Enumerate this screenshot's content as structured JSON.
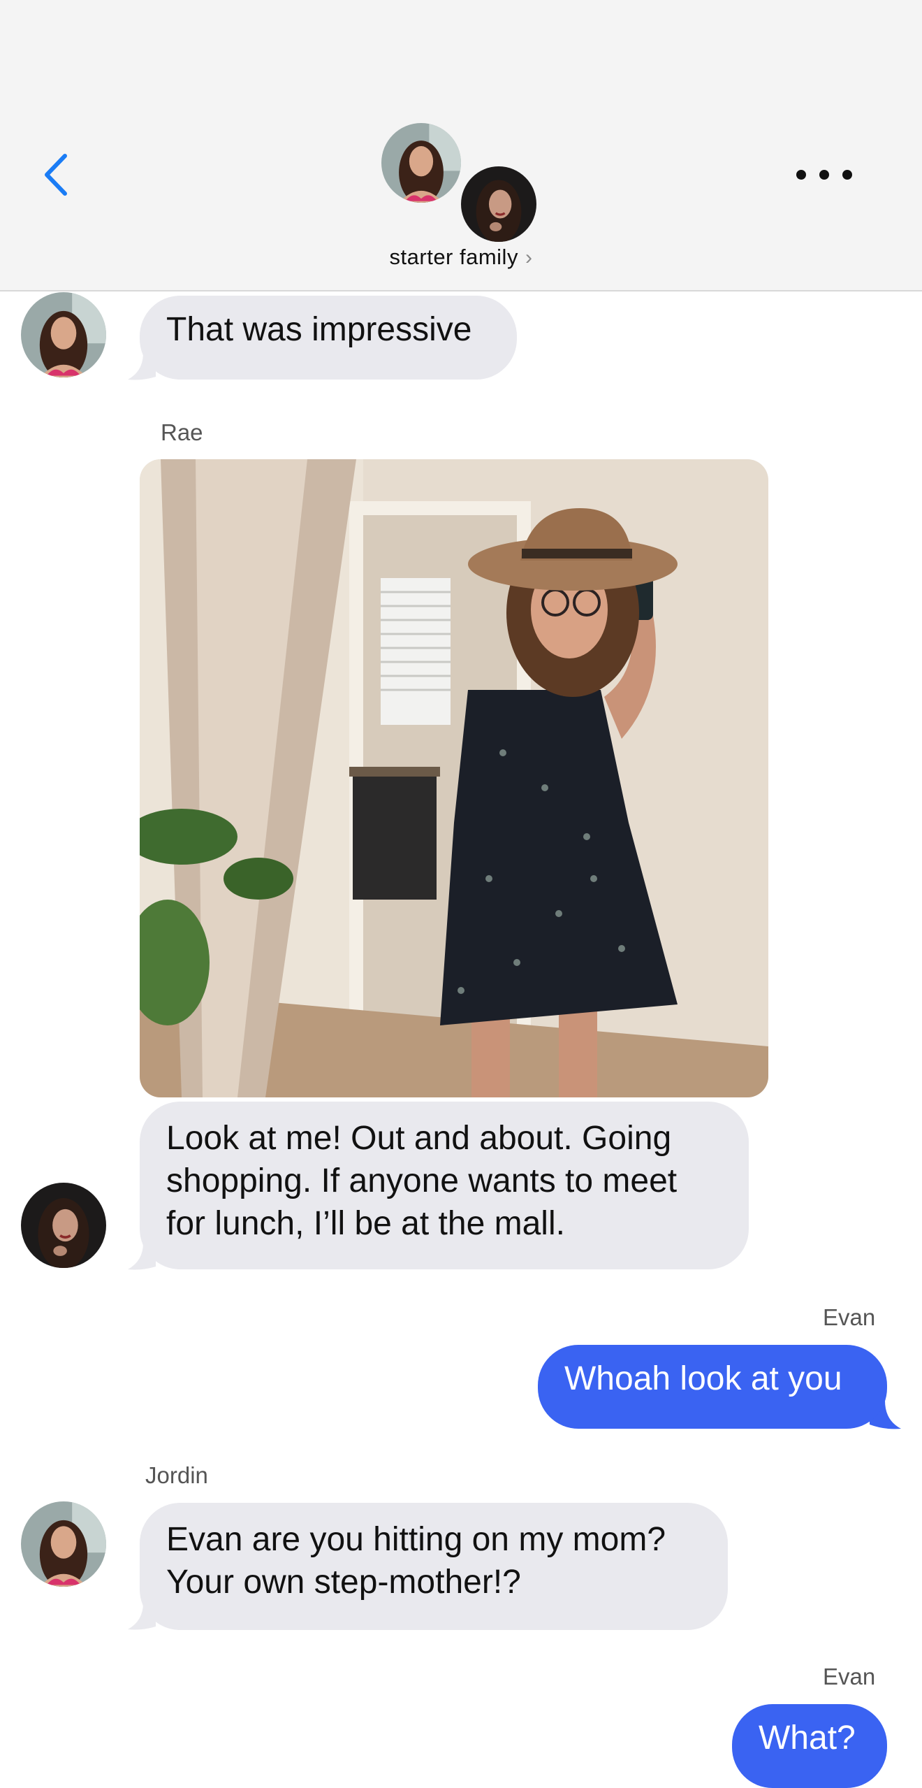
{
  "header": {
    "group_name": "starter family",
    "chevron": "›",
    "back_icon": "chevron-left-icon",
    "more_icon": "ellipsis-icon",
    "accent_color": "#1a7cf5"
  },
  "messages": [
    {
      "sender": "",
      "text": "That was impressive",
      "direction": "incoming"
    },
    {
      "sender": "Rae",
      "type": "photo",
      "photo_desc": "mirror selfie photo"
    },
    {
      "sender": "",
      "text": "Look at me! Out and about. Going shopping. If anyone wants to meet for lunch, I’ll be at the mall.",
      "direction": "incoming"
    },
    {
      "sender": "Evan",
      "text": "Whoah look at you",
      "direction": "outgoing"
    },
    {
      "sender": "Jordin",
      "text": "Evan are you hitting on my mom? Your own step-mother!?",
      "direction": "incoming"
    },
    {
      "sender": "Evan",
      "text": "What?",
      "direction": "outgoing"
    }
  ],
  "colors": {
    "incoming_bubble": "#e9e9ee",
    "outgoing_bubble": "#3a63f2",
    "header_bg": "#f4f4f4"
  }
}
